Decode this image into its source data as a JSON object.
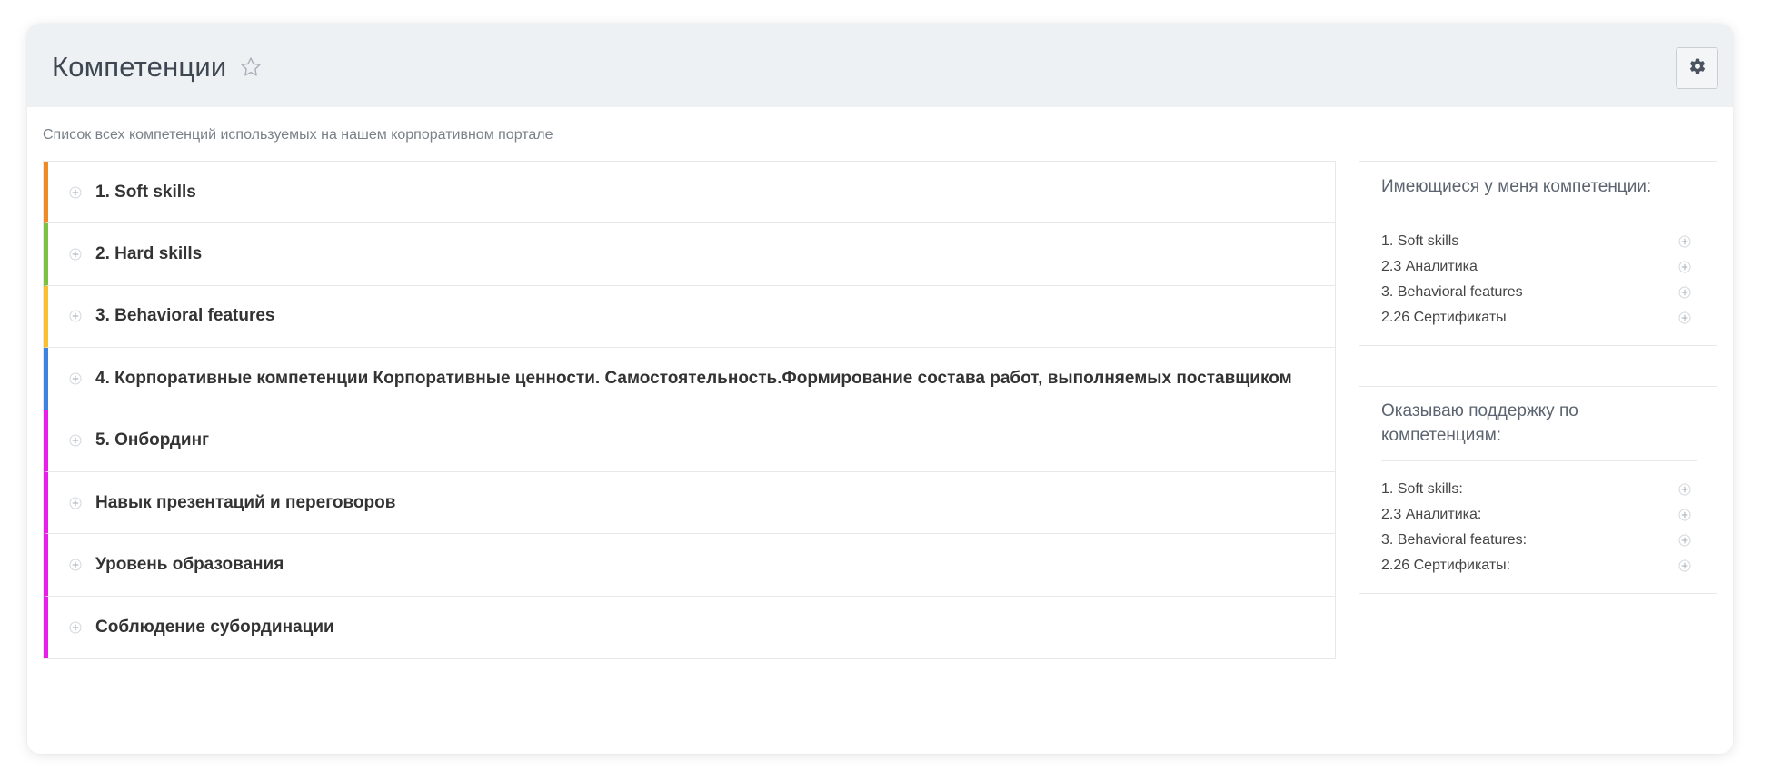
{
  "header": {
    "title": "Компетенции",
    "favorite_icon": "star-outline-icon",
    "settings_icon": "gear-icon"
  },
  "description": "Список всех компетенций используемых на нашем корпоративном портале",
  "competencies": [
    {
      "label": "1. Soft skills",
      "color": "#f08a24"
    },
    {
      "label": "2. Hard skills",
      "color": "#7cc242"
    },
    {
      "label": "3. Behavioral features",
      "color": "#fbc02d"
    },
    {
      "label": "4. Корпоративные компетенции Корпоративные ценности. Самостоятельность.Формирование состава работ, выполняемых поставщиком",
      "color": "#3f83e0"
    },
    {
      "label": "5. Онбординг",
      "color": "#e91eea"
    },
    {
      "label": "Навык презентаций и переговоров",
      "color": "#e91eea"
    },
    {
      "label": "Уровень образования",
      "color": "#e91eea"
    },
    {
      "label": "Соблюдение субординации",
      "color": "#e91eea"
    }
  ],
  "my_competencies": {
    "title": "Имеющиеся у меня компетенции:",
    "items": [
      "1. Soft skills",
      "2.3 Аналитика",
      "3. Behavioral features",
      "2.26 Сертификаты"
    ]
  },
  "support_competencies": {
    "title": "Оказываю поддержку по компетенциям:",
    "items": [
      "1. Soft skills:",
      "2.3 Аналитика:",
      "3. Behavioral features:",
      "2.26 Сертификаты:"
    ]
  },
  "item_icon": "plus-circle-icon"
}
